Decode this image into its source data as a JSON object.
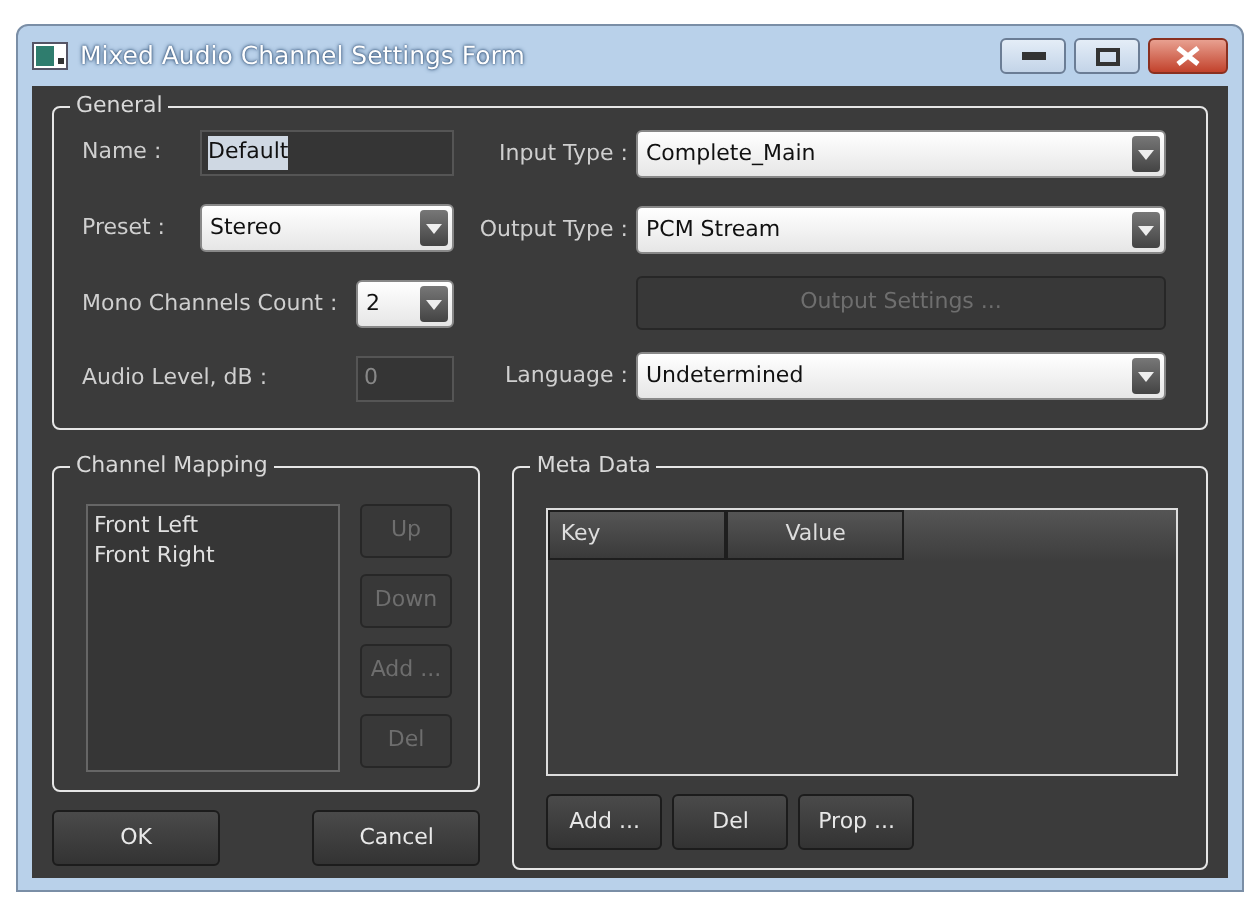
{
  "window": {
    "title": "Mixed Audio Channel Settings Form"
  },
  "general": {
    "legend": "General",
    "left_fields": [
      {
        "kind": "input",
        "label": "Name :",
        "value": "Default",
        "text_selected": true,
        "disabled": false
      },
      {
        "kind": "select",
        "label": "Preset :",
        "value": "Stereo",
        "disabled": false
      },
      {
        "kind": "select",
        "label": "Mono Channels Count :",
        "value": "2",
        "disabled": false
      },
      {
        "kind": "input",
        "label": "Audio Level, dB :",
        "value": "0",
        "text_selected": false,
        "disabled": true
      }
    ],
    "right_fields": [
      {
        "kind": "select",
        "label": "Input Type :",
        "value": "Complete_Main",
        "disabled": false
      },
      {
        "kind": "select",
        "label": "Output Type :",
        "value": "PCM Stream",
        "disabled": false
      },
      {
        "kind": "button",
        "label": "Output Settings ...",
        "disabled": true
      },
      {
        "kind": "select",
        "label": "Language :",
        "value": "Undetermined",
        "disabled": false
      }
    ]
  },
  "channel_mapping": {
    "legend": "Channel Mapping",
    "items": [
      "Front Left",
      "Front Right"
    ],
    "buttons": [
      {
        "label": "Up",
        "disabled": true
      },
      {
        "label": "Down",
        "disabled": true
      },
      {
        "label": "Add ...",
        "disabled": true
      },
      {
        "label": "Del",
        "disabled": true
      }
    ]
  },
  "meta_data": {
    "legend": "Meta Data",
    "columns": [
      "Key",
      "Value"
    ],
    "buttons": [
      {
        "label": "Add ...",
        "disabled": false
      },
      {
        "label": "Del",
        "disabled": false
      },
      {
        "label": "Prop ...",
        "disabled": false
      }
    ]
  },
  "dialog_buttons": [
    {
      "label": "OK",
      "disabled": false
    },
    {
      "label": "Cancel",
      "disabled": false
    }
  ]
}
